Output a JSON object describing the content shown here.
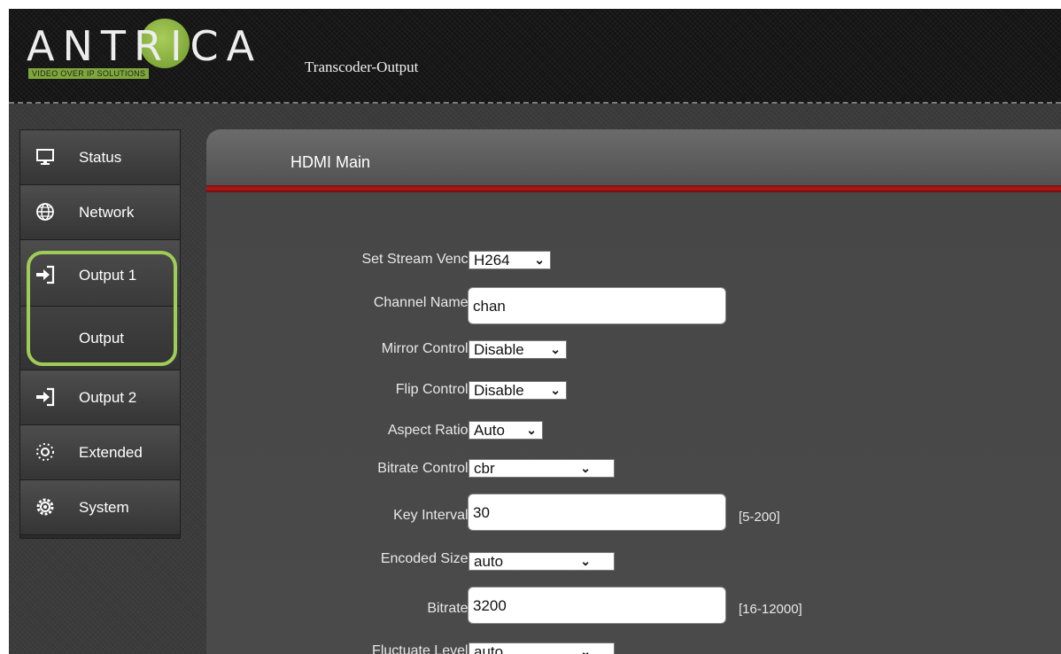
{
  "brand": {
    "name": "ANTRICA",
    "tagline": "VIDEO OVER IP SOLUTIONS",
    "accent": "#9fcc57"
  },
  "header": {
    "title": "Transcoder-Output"
  },
  "sidebar": {
    "items": [
      {
        "label": "Status",
        "icon": "monitor-icon"
      },
      {
        "label": "Network",
        "icon": "globe-icon"
      },
      {
        "label": "Output 1",
        "icon": "sign-in-arrow-icon"
      },
      {
        "label": "Output"
      },
      {
        "label": "Output 2",
        "icon": "sign-in-arrow-icon"
      },
      {
        "label": "Extended",
        "icon": "dotted-cog-icon"
      },
      {
        "label": "System",
        "icon": "settings-gear-icon"
      }
    ]
  },
  "panel": {
    "title": "HDMI Main",
    "accent": "#b01818",
    "fields": {
      "stream_venc": {
        "label": "Set Stream Venc:",
        "value": "H264"
      },
      "channel_name": {
        "label": "Channel Name:",
        "value": "chan"
      },
      "mirror_control": {
        "label": "Mirror Control:",
        "value": "Disable"
      },
      "flip_control": {
        "label": "Flip Control:",
        "value": "Disable"
      },
      "aspect_ratio": {
        "label": "Aspect Ratio:",
        "value": "Auto"
      },
      "bitrate_control": {
        "label": "Bitrate Control:",
        "value": "cbr"
      },
      "key_interval": {
        "label": "Key Interval:",
        "value": "30",
        "range": "[5-200]"
      },
      "encoded_size": {
        "label": "Encoded Size:",
        "value": "auto"
      },
      "bitrate": {
        "label": "Bitrate:",
        "value": "3200",
        "range": "[16-12000]"
      },
      "fluctuate_level": {
        "label": "Fluctuate Level:",
        "value": "auto"
      }
    }
  }
}
